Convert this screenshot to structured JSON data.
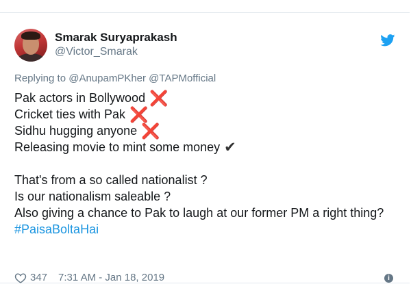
{
  "tweet": {
    "author_name": "Smarak Suryaprakash",
    "author_handle": "@Victor_Smarak",
    "replying_label": "Replying to",
    "reply_mentions": "@AnupamPKher @TAPMofficial",
    "lines": {
      "l1": "Pak actors in Bollywood",
      "l2": "Cricket ties with Pak",
      "l3": "Sidhu hugging anyone",
      "l4": "Releasing movie to mint some money",
      "l5": "That's from a so called nationalist ?",
      "l6": "Is our nationalism saleable ?",
      "l7": "Also giving a chance to Pak to laugh at our former PM a right thing?",
      "hashtag": "#PaisaBoltaHai"
    },
    "cross_mark": "❌",
    "check_mark": "✔",
    "likes_count": "347",
    "timestamp": "7:31 AM - Jan 18, 2019",
    "info_glyph": "i",
    "icons": {
      "platform": "twitter-bird-icon",
      "like": "heart-icon",
      "info": "info-icon"
    },
    "colors": {
      "hashtag": "#1b95e0",
      "twitter_blue": "#1da1f2",
      "cross_red": "#dd2e44",
      "muted_text": "#657786"
    }
  }
}
